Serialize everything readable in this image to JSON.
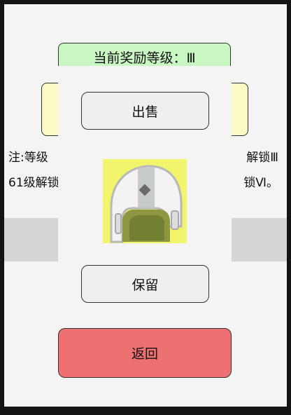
{
  "reward_level": {
    "label": "当前奖励等级：Ⅲ"
  },
  "notes": {
    "line1_left": "注:等级",
    "line1_right": "解锁Ⅲ",
    "line2_left": "61级解锁",
    "line2_right": "锁Ⅵ。"
  },
  "dialog": {
    "sell_label": "出售",
    "keep_label": "保留",
    "item": {
      "icon": "helmet-icon"
    }
  },
  "footer": {
    "back_label": "返回"
  },
  "colors": {
    "banner": "#c8f7c2",
    "reward_box": "#fafac6",
    "back_button": "#ee7171",
    "item_background": "#f2f56b"
  }
}
